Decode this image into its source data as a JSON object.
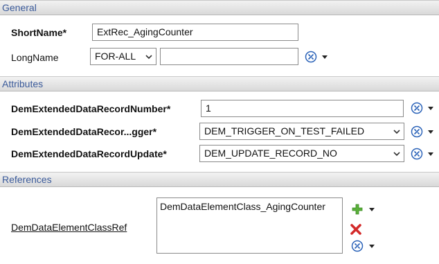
{
  "sections": {
    "general": "General",
    "attributes": "Attributes",
    "references": "References"
  },
  "general": {
    "shortname_label": "ShortName*",
    "shortname_value": "ExtRec_AgingCounter",
    "longname_label": "LongName",
    "longname_lang": "FOR-ALL",
    "longname_value": ""
  },
  "attributes": {
    "record_number_label": "DemExtendedDataRecordNumber*",
    "record_number_value": "1",
    "trigger_label": "DemExtendedDataRecor...gger*",
    "trigger_value": "DEM_TRIGGER_ON_TEST_FAILED",
    "update_label": "DemExtendedDataRecordUpdate*",
    "update_value": "DEM_UPDATE_RECORD_NO"
  },
  "references": {
    "class_ref_label": "DemDataElementClassRef",
    "class_ref_items": [
      "DemDataElementClass_AgingCounter"
    ]
  },
  "icons": {
    "tool": "wrench-circle-icon",
    "add": "plus-icon",
    "delete": "delete-x-icon",
    "dropdown": "dropdown-arrow-icon"
  },
  "colors": {
    "section_text": "#3a5a9a",
    "tool_blue": "#2a62b8",
    "add_green": "#5ab03a",
    "delete_red": "#d32a2a"
  }
}
